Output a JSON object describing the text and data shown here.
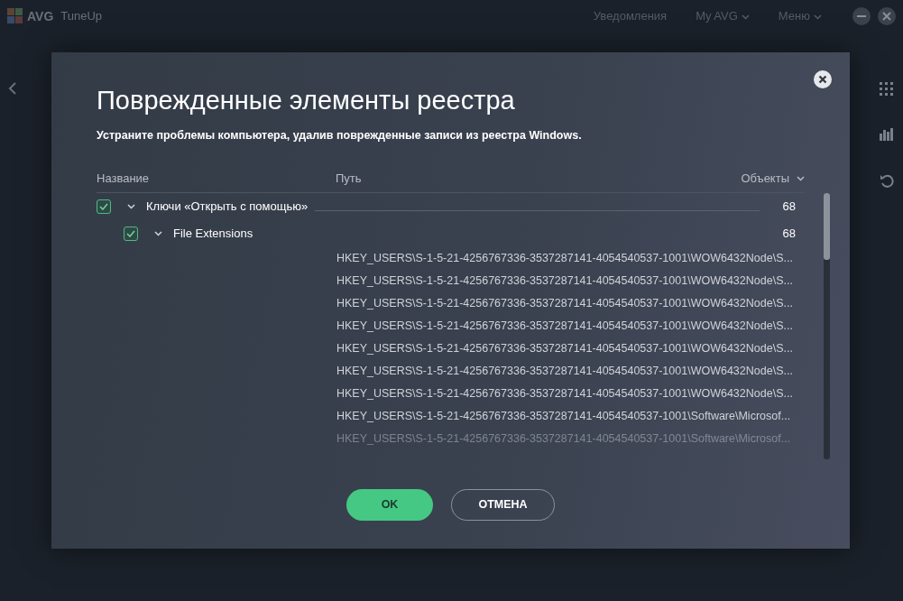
{
  "app": {
    "logo": "AVG",
    "title": "TuneUp",
    "nav": [
      {
        "label": "Уведомления",
        "dropdown": false
      },
      {
        "label": "My AVG",
        "dropdown": true
      },
      {
        "label": "Меню",
        "dropdown": true
      }
    ]
  },
  "dialog": {
    "title": "Поврежденные элементы реестра",
    "subtitle": "Устраните проблемы компьютера, удалив поврежденные записи из реестра Windows.",
    "columns": [
      {
        "label": "Название",
        "sortable": false
      },
      {
        "label": "Путь",
        "sortable": false
      },
      {
        "label": "Объекты",
        "sortable": true
      }
    ],
    "tree": [
      {
        "name": "Ключи «Открыть с помощью»",
        "checked": true,
        "expanded": true,
        "count": "68",
        "children": [
          {
            "name": "File Extensions",
            "checked": true,
            "expanded": true,
            "count": "68",
            "children": [
              {
                "path": "HKEY_USERS\\S-1-5-21-4256767336-3537287141-4054540537-1001\\WOW6432Node\\S...",
                "faded": false
              },
              {
                "path": "HKEY_USERS\\S-1-5-21-4256767336-3537287141-4054540537-1001\\WOW6432Node\\S...",
                "faded": false
              },
              {
                "path": "HKEY_USERS\\S-1-5-21-4256767336-3537287141-4054540537-1001\\WOW6432Node\\S...",
                "faded": false
              },
              {
                "path": "HKEY_USERS\\S-1-5-21-4256767336-3537287141-4054540537-1001\\WOW6432Node\\S...",
                "faded": false
              },
              {
                "path": "HKEY_USERS\\S-1-5-21-4256767336-3537287141-4054540537-1001\\WOW6432Node\\S...",
                "faded": false
              },
              {
                "path": "HKEY_USERS\\S-1-5-21-4256767336-3537287141-4054540537-1001\\WOW6432Node\\S...",
                "faded": false
              },
              {
                "path": "HKEY_USERS\\S-1-5-21-4256767336-3537287141-4054540537-1001\\WOW6432Node\\S...",
                "faded": false
              },
              {
                "path": "HKEY_USERS\\S-1-5-21-4256767336-3537287141-4054540537-1001\\Software\\Microsof...",
                "faded": false
              },
              {
                "path": "HKEY_USERS\\S-1-5-21-4256767336-3537287141-4054540537-1001\\Software\\Microsof...",
                "faded": true
              }
            ]
          }
        ]
      }
    ],
    "buttons": [
      {
        "label": "OK",
        "kind": "primary"
      },
      {
        "label": "ОТМЕНА",
        "kind": "secondary"
      }
    ]
  }
}
